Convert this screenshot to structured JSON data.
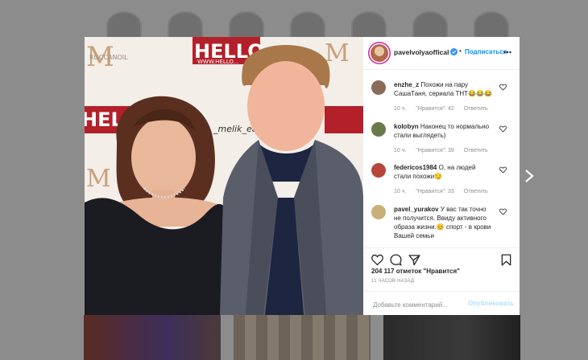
{
  "post": {
    "username": "pavelvolyaoffical",
    "dot": "•",
    "follow_label": "Подписаться",
    "more_icon": "more-dots-icon",
    "likes_text": "204 117 отметок \"Нравится\"",
    "time_ago": "11 ЧАСОВ НАЗАД"
  },
  "photo": {
    "logo_text_1": "HELLO",
    "logo_text_2": "HELLO",
    "tagline": "WWW.HELLO...",
    "banner_m": "M",
    "banner_oil": "ROCCANOIL",
    "watermark": "_melik_ea"
  },
  "comments": [
    {
      "user": "enzhe_z",
      "text": "Похожи на пару СашаТаня, сериала ТНТ😂😂😂",
      "time": "10 ч.",
      "likes": "\"Нравится\": 42",
      "reply": "Ответить",
      "avatar_color": "#8a6b5a"
    },
    {
      "user": "kolobyn",
      "text": "Наконец то нормально стали выглядеть)",
      "time": "10 ч.",
      "likes": "\"Нравится\": 39",
      "reply": "Ответить",
      "avatar_color": "#6b7a4a"
    },
    {
      "user": "federicos1984",
      "text": "О, на людей стали похожи😏",
      "time": "10 ч.",
      "likes": "\"Нравится\": 33",
      "reply": "Ответить",
      "avatar_color": "#b7473b"
    },
    {
      "user": "pavel_yurakov",
      "text": "У вас так точно не получится. Ввиду активного образа жизни.😊 спорт - в крови Вашей семьи",
      "time": "",
      "likes": "",
      "reply": "",
      "avatar_color": "#c9b07a"
    }
  ],
  "add_comment": {
    "placeholder": "Добавьте комментарий...",
    "publish_label": "Опубликовать"
  },
  "colors": {
    "accent": "#0095f6",
    "publish_disabled": "#b2dffc",
    "overlay": "#8c8c8c"
  },
  "icons": [
    "heart-icon",
    "comment-icon",
    "share-icon",
    "bookmark-icon",
    "chevron-right-icon",
    "verified-icon"
  ]
}
